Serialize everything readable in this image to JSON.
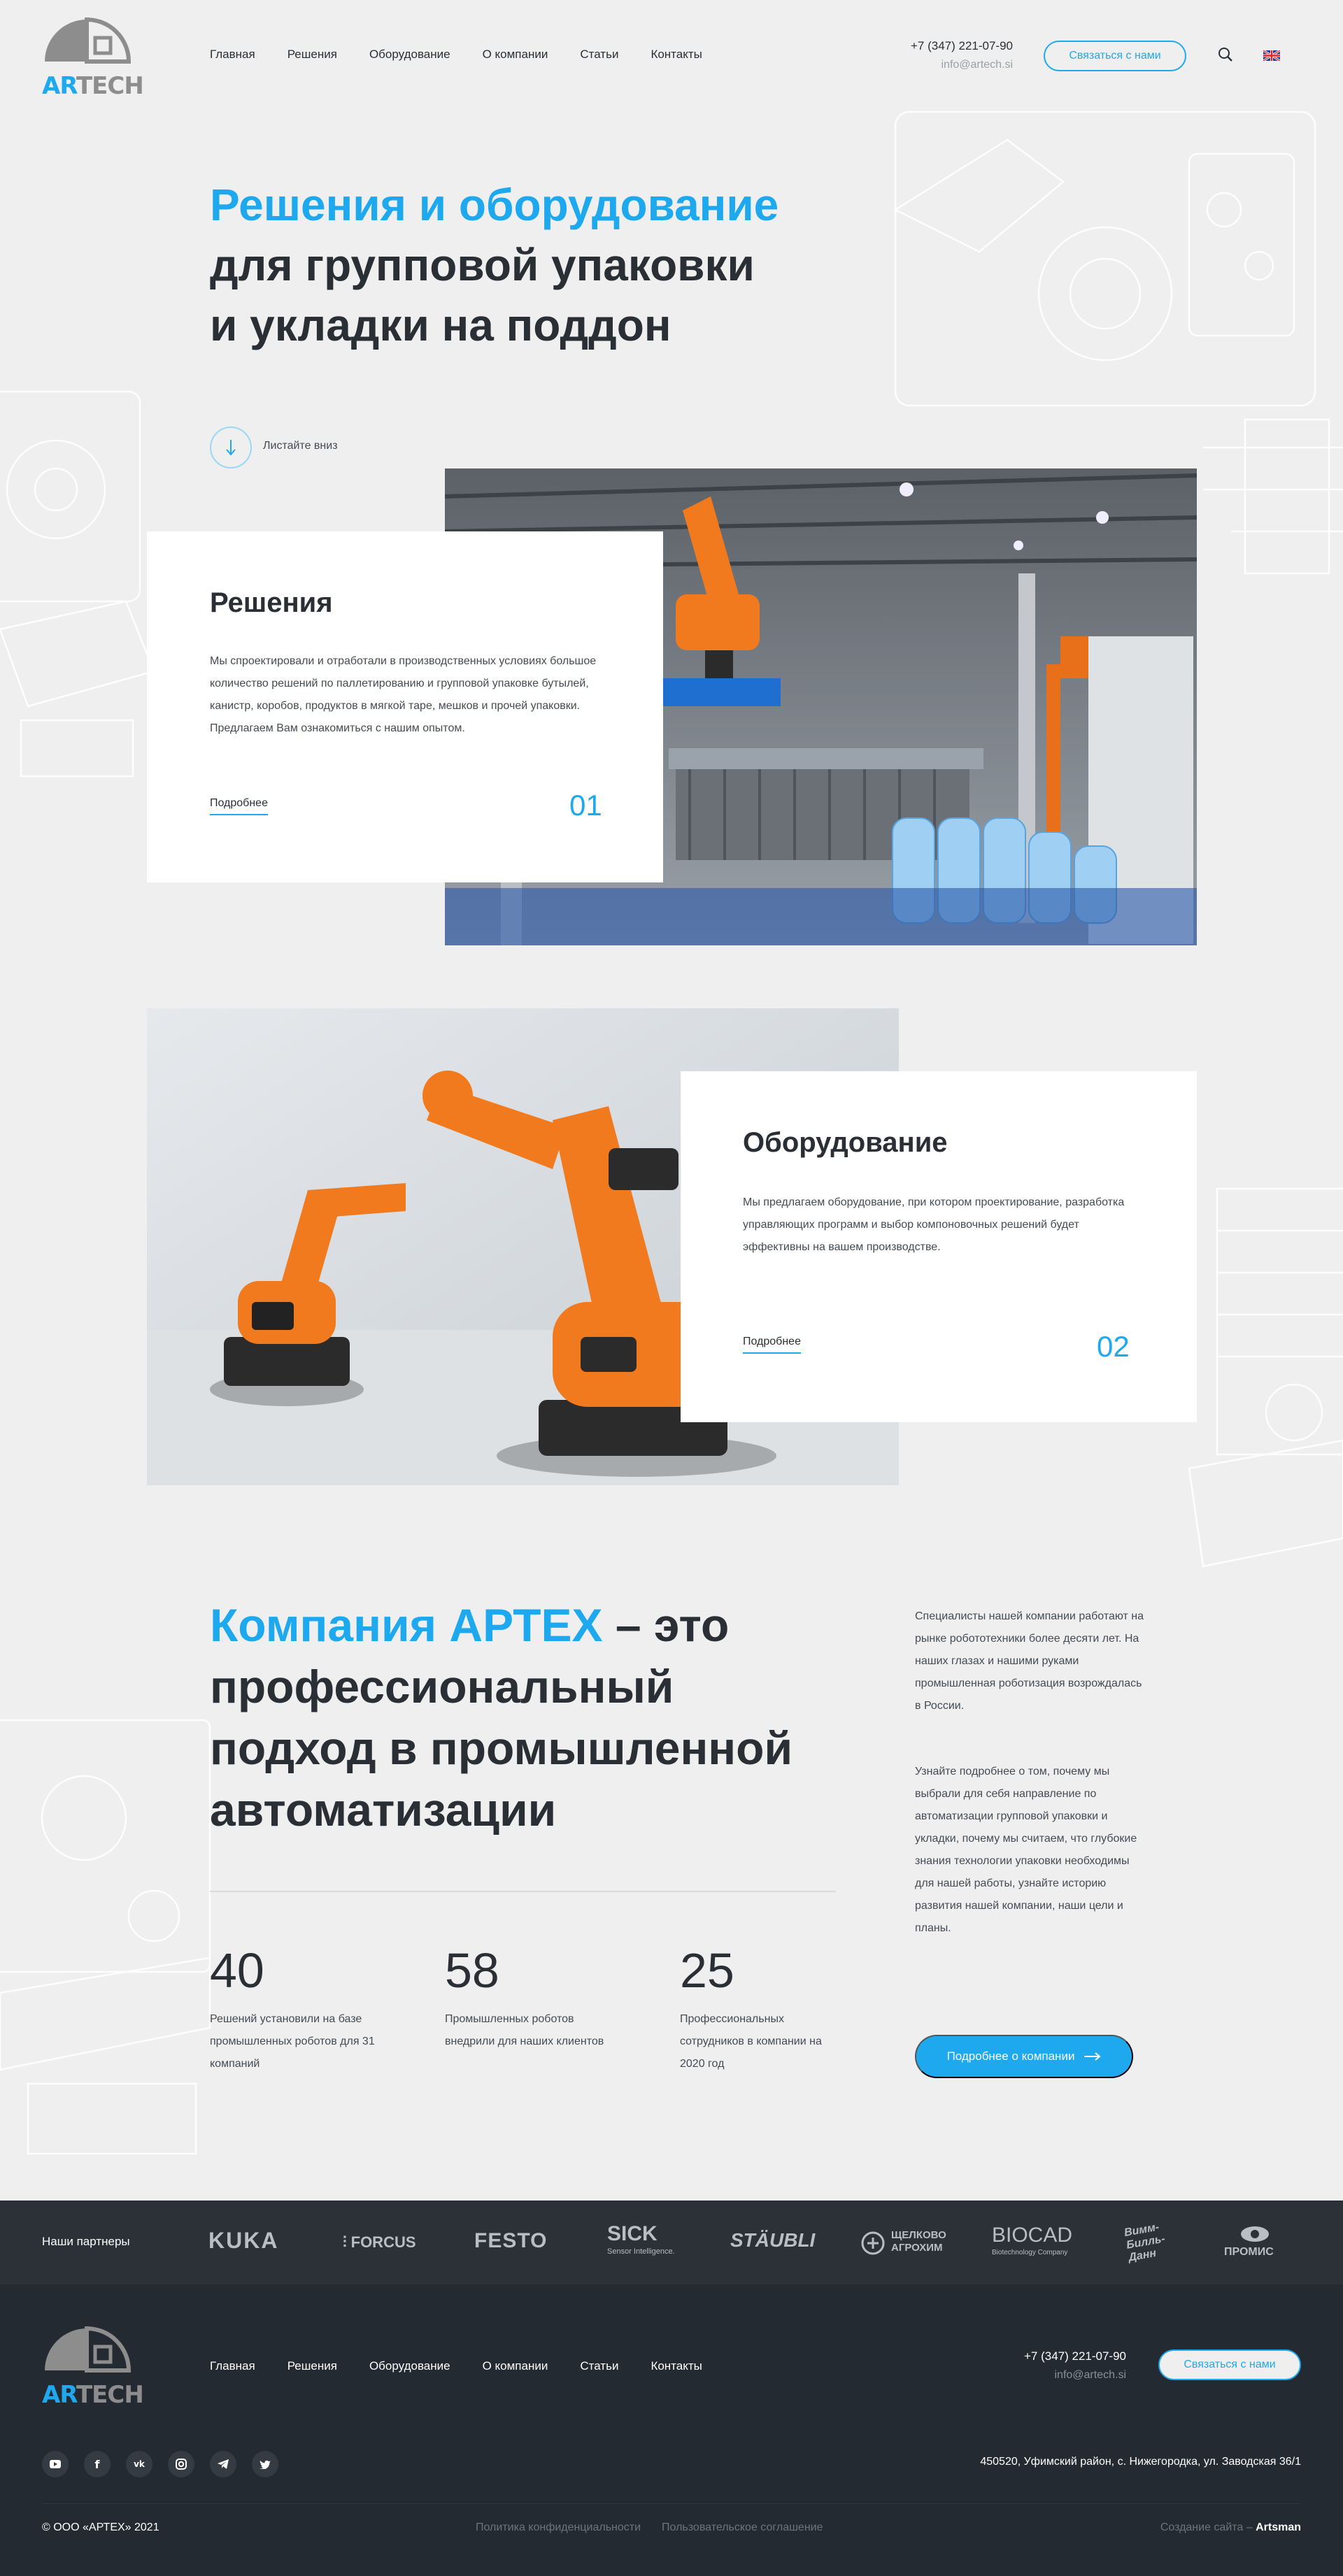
{
  "header": {
    "logo_ar": "AR",
    "logo_tech": "TECH",
    "nav": [
      "Главная",
      "Решения",
      "Оборудование",
      "О компании",
      "Статьи",
      "Контакты"
    ],
    "phone": "+7 (347) 221-07-90",
    "email": "info@artech.si",
    "cta": "Связаться с нами",
    "search_icon": "search-icon",
    "lang_icon": "uk-flag-icon"
  },
  "hero": {
    "title_blue": "Решения и оборудование",
    "title_line2": "для групповой упаковки",
    "title_line3": "и укладки на поддон",
    "scroll_label": "Листайте вниз"
  },
  "solutions": {
    "title": "Решения",
    "text": "Мы спроектировали и отработали в производственных условиях большое количество решений по паллетированию и групповой упаковке бутылей, канистр, коробов, продуктов в мягкой таре, мешков и прочей упаковки. Предлагаем Вам ознакомиться с нашим опытом.",
    "link": "Подробнее",
    "num": "01"
  },
  "equipment": {
    "title": "Оборудование",
    "text": "Мы предлагаем оборудование, при котором проектирование, разработка управляющих программ и выбор компоновочных решений будет эффективны на вашем производстве.",
    "link": "Подробнее",
    "num": "02"
  },
  "company": {
    "title_blue": "Компания АРТЕХ",
    "title_rest": " – это профессиональный подход в промышленной автоматизации",
    "side_p1": "Специалисты нашей компании работают на рынке робототехники более десяти лет. На наших глазах и нашими руками промышленная роботизация возрождалась в России.",
    "side_p2": "Узнайте подробнее о том, почему мы выбрали для себя направление по автоматизации групповой упаковки и укладки, почему мы считаем, что глубокие знания технологии упаковки необходимы для нашей работы, узнайте историю развития нашей компании, наши цели и планы.",
    "cta": "Подробнее о компании",
    "stats": [
      {
        "num": "40",
        "text": "Решений установили на базе промышленных роботов для 31 компаний"
      },
      {
        "num": "58",
        "text": "Промышленных роботов внедрили для наших клиентов"
      },
      {
        "num": "25",
        "text": "Профессиональных сотрудников в компании на 2020 год"
      }
    ]
  },
  "partners": {
    "label": "Наши партнеры",
    "logos": [
      "KUKA",
      "FORCUS",
      "FESTO",
      "SICK",
      "Sensor Intelligence.",
      "STÄUBLI",
      "ЩЕЛКОВО",
      "АГРОХИМ",
      "BIOCAD",
      "Biotechnology Company",
      "Вимм-Билль-Данн",
      "ПРОМИС"
    ]
  },
  "footer": {
    "nav": [
      "Главная",
      "Решения",
      "Оборудование",
      "О компании",
      "Статьи",
      "Контакты"
    ],
    "phone": "+7 (347) 221-07-90",
    "email": "info@artech.si",
    "cta": "Связаться с нами",
    "address": "450520, Уфимский район, с. Нижегородка, ул. Заводская 36/1",
    "copyright": "© ООО «АРТЕХ» 2021",
    "policy": "Политика конфиденциальности",
    "agreement": "Пользовательское соглашение",
    "dev_label": "Создание сайта – ",
    "dev_name": "Artsman",
    "social": [
      "youtube-icon",
      "facebook-icon",
      "vk-icon",
      "instagram-icon",
      "telegram-icon",
      "twitter-icon"
    ]
  },
  "colors": {
    "accent": "#1ea9ef",
    "dark": "#2a2f35",
    "bg": "#efefef",
    "footer": "#232a31",
    "robot_orange": "#f07a1d"
  }
}
